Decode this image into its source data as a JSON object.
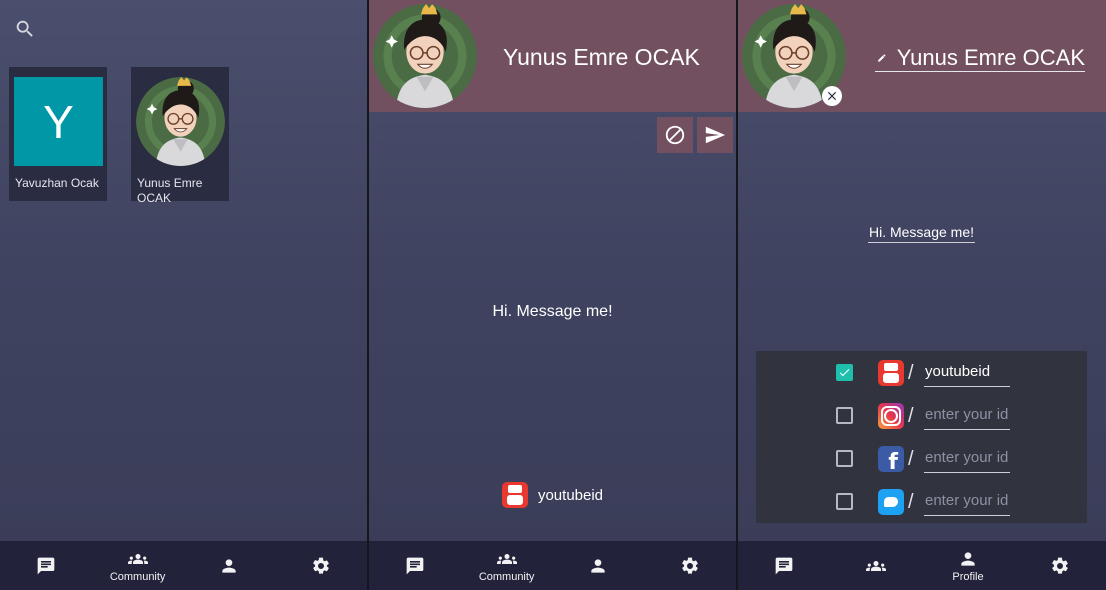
{
  "colors": {
    "header_bg": "#725060",
    "bottom_nav_bg": "#22223a",
    "letter_avatar_bg": "#0097a7",
    "checkbox_checked": "#1fbfae"
  },
  "bottom_nav": {
    "chats_icon": "chat-bubble-icon",
    "community_icon": "community-icon",
    "community_label": "Community",
    "profile_icon": "person-icon",
    "profile_label": "Profile",
    "settings_icon": "gear-icon"
  },
  "community_screen": {
    "search_icon": "search-icon",
    "users": [
      {
        "initial": "Y",
        "name": "Yavuzhan Ocak"
      },
      {
        "name": "Yunus Emre OCAK"
      }
    ]
  },
  "user_profile_screen": {
    "name": "Yunus Emre OCAK",
    "block_icon": "block-icon",
    "send_icon": "send-icon",
    "status": "Hi. Message me!",
    "social": {
      "icon": "youtube-icon",
      "handle": "youtubeid"
    }
  },
  "edit_profile_screen": {
    "name": "Yunus Emre OCAK",
    "edit_icon": "pencil-icon",
    "remove_avatar_icon": "close-icon",
    "status": "Hi. Message me!",
    "separator": "/",
    "social_accounts": [
      {
        "platform": "youtube-icon",
        "checked": true,
        "value": "youtubeid"
      },
      {
        "platform": "instagram-icon",
        "checked": false,
        "placeholder": "enter your id"
      },
      {
        "platform": "facebook-icon",
        "checked": false,
        "placeholder": "enter your id"
      },
      {
        "platform": "twitter-icon",
        "checked": false,
        "placeholder": "enter your id"
      }
    ]
  }
}
